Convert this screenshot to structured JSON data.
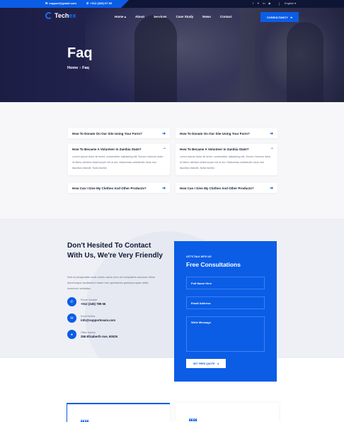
{
  "topbar": {
    "email": "support@gmail.com",
    "phone": "+012 (345) 67 89",
    "language": "English"
  },
  "brand": {
    "name_main": "Tech",
    "name_accent": "ex"
  },
  "nav": {
    "items": [
      "Home",
      "About",
      "Services",
      "Case Study",
      "News",
      "Contact"
    ],
    "cta_label": "CONSULTANCY"
  },
  "hero": {
    "title": "Faq",
    "breadcrumb": [
      "Home",
      "Faq"
    ]
  },
  "faq": {
    "left": [
      {
        "q": "How To Donate On Our Site Using Your Form?",
        "icon": "+"
      },
      {
        "q": "How To Became A Volunteer In Zambia State?",
        "icon": "−",
        "a": "Lorem ipsum dolor sit amet, consectetur adipiscing elit. Donec rhoncus dolor id libero ultricies ullamcorper vel ut dui. Maecenas sollicitudin risus non faucibus blandit. Nulla facilisi."
      },
      {
        "q": "How Can I Give My Clothes And Other Products?",
        "icon": "+"
      }
    ],
    "right": [
      {
        "q": "How To Donate On Our Site Using Your Form?",
        "icon": "+"
      },
      {
        "q": "How To Became A Volunteer In Zambia State?",
        "icon": "−",
        "a": "Lorem ipsum dolor sit amet, consectetur adipiscing elit. Donec rhoncus dolor id libero ultricies ullamcorper vel ut dui. Maecenas sollicitudin risus non faucibus blandit. Nulla facilisi."
      },
      {
        "q": "How Can I Give My Clothes And Other Products?",
        "icon": "+"
      }
    ]
  },
  "contact": {
    "title": "Don't Hesited To Contact With Us, We're Very Friendly",
    "text": "Sed ut perspiciatis unde omnis natus error sit voluptatem accusan etium doloremque laudantium totam rem aperiamea queepsa quae abillo inventore veritatise.",
    "phone_label": "Phone Number",
    "phone": "+012 (345) 789 66",
    "email_label": "Email Adress",
    "email": "info@supportexam.com",
    "office_label": "Office Adress",
    "office": "256 Elizaberth Ave, 90025"
  },
  "form": {
    "eyebrow": "LET'S TALK WITH US",
    "title": "Free Consultations",
    "name_placeholder": "Full Name Here",
    "email_placeholder": "Email Address",
    "message_placeholder": "Write Message",
    "button": "GET FREE QUOTE"
  },
  "colors": {
    "accent": "#0b5de6",
    "dark": "#0f1535",
    "text": "#0e1a35"
  }
}
